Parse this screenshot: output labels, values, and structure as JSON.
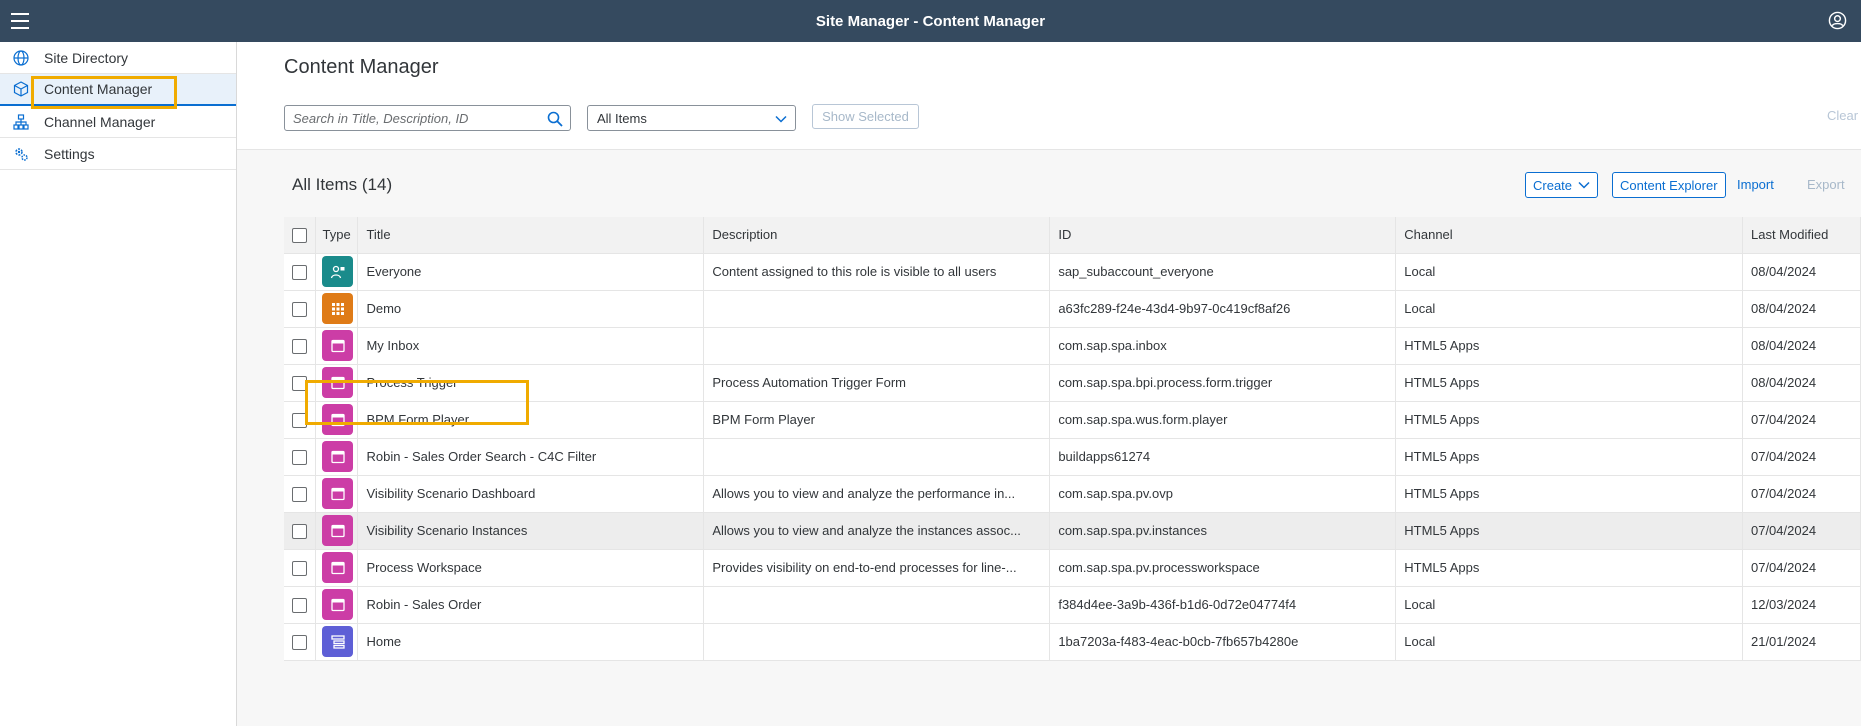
{
  "shell": {
    "title": "Site Manager - Content Manager"
  },
  "sidebar": {
    "items": [
      {
        "label": "Site Directory",
        "icon": "globe-icon"
      },
      {
        "label": "Content Manager",
        "icon": "box-icon",
        "selected": true
      },
      {
        "label": "Channel Manager",
        "icon": "hierarchy-icon"
      },
      {
        "label": "Settings",
        "icon": "gear-icon"
      }
    ]
  },
  "header": {
    "title": "Content Manager",
    "search_placeholder": "Search in Title, Description, ID",
    "filter_value": "All Items",
    "show_selected_label": "Show Selected",
    "clear_label": "Clear"
  },
  "table": {
    "title": "All Items (14)",
    "toolbar": {
      "create": "Create",
      "content_explorer": "Content Explorer",
      "import": "Import",
      "export": "Export"
    },
    "columns": [
      "Type",
      "Title",
      "Description",
      "ID",
      "Channel",
      "Last Modified"
    ],
    "rows": [
      {
        "type": "role",
        "color": "#1a8b8b",
        "title": "Everyone",
        "description": "Content assigned to this role is visible to all users",
        "id": "sap_subaccount_everyone",
        "channel": "Local",
        "modified": "08/04/2024"
      },
      {
        "type": "group",
        "color": "#df7b17",
        "title": "Demo",
        "description": "",
        "id": "a63fc289-f24e-43d4-9b97-0c419cf8af26",
        "channel": "Local",
        "modified": "08/04/2024"
      },
      {
        "type": "app",
        "color": "#cc3da6",
        "title": "My Inbox",
        "description": "",
        "id": "com.sap.spa.inbox",
        "channel": "HTML5 Apps",
        "modified": "08/04/2024"
      },
      {
        "type": "app",
        "color": "#cc3da6",
        "title": "Process Trigger",
        "description": "Process Automation Trigger Form",
        "id": "com.sap.spa.bpi.process.form.trigger",
        "channel": "HTML5 Apps",
        "modified": "08/04/2024"
      },
      {
        "type": "app",
        "color": "#cc3da6",
        "title": "BPM Form Player",
        "description": "BPM Form Player",
        "id": "com.sap.spa.wus.form.player",
        "channel": "HTML5 Apps",
        "modified": "07/04/2024"
      },
      {
        "type": "app",
        "color": "#cc3da6",
        "title": "Robin - Sales Order Search - C4C Filter",
        "description": "",
        "id": "buildapps61274",
        "channel": "HTML5 Apps",
        "modified": "07/04/2024"
      },
      {
        "type": "app",
        "color": "#cc3da6",
        "title": "Visibility Scenario Dashboard",
        "description": "Allows you to view and analyze the performance in...",
        "id": "com.sap.spa.pv.ovp",
        "channel": "HTML5 Apps",
        "modified": "07/04/2024"
      },
      {
        "type": "app",
        "color": "#cc3da6",
        "title": "Visibility Scenario Instances",
        "description": "Allows you to view and analyze the instances assoc...",
        "id": "com.sap.spa.pv.instances",
        "channel": "HTML5 Apps",
        "modified": "07/04/2024"
      },
      {
        "type": "app",
        "color": "#cc3da6",
        "title": "Process Workspace",
        "description": "Provides visibility on end-to-end processes for line-...",
        "id": "com.sap.spa.pv.processworkspace",
        "channel": "HTML5 Apps",
        "modified": "07/04/2024"
      },
      {
        "type": "app",
        "color": "#cc3da6",
        "title": "Robin - Sales Order",
        "description": "",
        "id": "f384d4ee-3a9b-436f-b1d6-0d72e04774f4",
        "channel": "Local",
        "modified": "12/03/2024"
      },
      {
        "type": "space",
        "color": "#5e5fd6",
        "title": "Home",
        "description": "",
        "id": "1ba7203a-f483-4eac-b0cb-7fb657b4280e",
        "channel": "Local",
        "modified": "21/01/2024"
      }
    ]
  }
}
